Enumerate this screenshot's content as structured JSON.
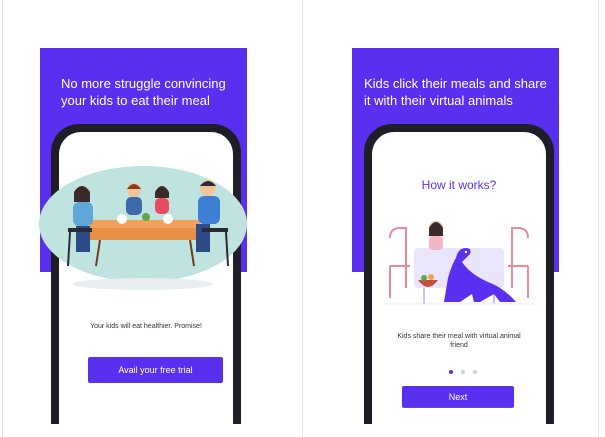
{
  "screens": [
    {
      "headline": "No more struggle convincing\nyour kids to eat their meal",
      "caption": "Your kids will eat healthier. Promise!",
      "button_label": "Avail your free trial"
    },
    {
      "headline": "Kids click their meals and share\nit with their virtual animals",
      "section_title": "How it works?",
      "caption": "Kids share their meal with virtual animal\nfriend",
      "button_label": "Next",
      "page_indicator": {
        "total": 3,
        "active": 1
      }
    }
  ],
  "colors": {
    "brand": "#5b2ff0",
    "phone_frame": "#1f1d26",
    "bubble": "#bfe3df"
  },
  "illustrations": {
    "screen1": "family-dinner-table-illustration",
    "screen2": "girl-with-dinosaur-at-table-illustration"
  }
}
